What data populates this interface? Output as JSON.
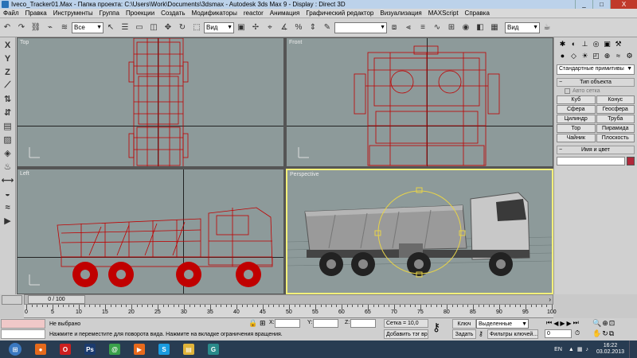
{
  "window": {
    "title": "Iveco_Tracker01.Max    - Папка проекта: C:\\Users\\Work\\Documents\\3dsmax    - Autodesk 3ds Max 9    - Display : Direct 3D",
    "minimize": "_",
    "maximize": "□",
    "close": "X"
  },
  "menu": [
    "Файл",
    "Правка",
    "Инструменты",
    "Группа",
    "Проекции",
    "Создать",
    "Модификаторы",
    "reactor",
    "Анимация",
    "Графический редактор",
    "Визуализация",
    "MAXScript",
    "Справка"
  ],
  "toolbar": {
    "selection_filter": "Все",
    "coord_system": "Вид",
    "named_selection": "",
    "render_view": "Вид"
  },
  "left_toolbar": [
    "X",
    "Y",
    "Z"
  ],
  "viewports": {
    "top": "Top",
    "front": "Front",
    "left": "Left",
    "perspective": "Perspective"
  },
  "command_panel": {
    "category": "Стандартные примитивы",
    "rollout_object_type": "Тип объекта",
    "auto_grid": "Авто сетка",
    "buttons": [
      "Куб",
      "Конус",
      "Сфера",
      "Геосфера",
      "Цилиндр",
      "Труба",
      "Тор",
      "Пирамида",
      "Чайник",
      "Плоскость"
    ],
    "rollout_name_color": "Имя и цвет",
    "object_color": "#b0283a"
  },
  "timeline": {
    "frame_display": "0 / 100",
    "ticks": [
      "0",
      "5",
      "10",
      "15",
      "20",
      "25",
      "30",
      "35",
      "40",
      "45",
      "50",
      "55",
      "60",
      "65",
      "70",
      "75",
      "80",
      "85",
      "90",
      "95",
      "100"
    ]
  },
  "status": {
    "selection": "Не выбрано",
    "prompt": "Нажмите и переместите для поворота вида. Нажмите на вкладке ограничения вращения.",
    "x_label": "X:",
    "y_label": "Y:",
    "z_label": "Z:",
    "x_value": "",
    "y_value": "",
    "z_value": "",
    "grid": "Сетка = 10,0",
    "add_time_tag": "Добавить тэг врем",
    "auto_key": "Ключ",
    "set_key": "Задать",
    "key_mode": "Выделенные",
    "key_filters": "Фильтры ключей...",
    "current_frame": "0"
  },
  "taskbar": {
    "apps": [
      {
        "name": "start-button",
        "color": "#3a78c0",
        "glyph": "⊞"
      },
      {
        "name": "firefox",
        "color": "#e56a1c",
        "glyph": "●"
      },
      {
        "name": "opera",
        "color": "#cc1f1f",
        "glyph": "O"
      },
      {
        "name": "photoshop",
        "color": "#1b3b6e",
        "glyph": "Ps"
      },
      {
        "name": "icq",
        "color": "#3aa14a",
        "glyph": "@"
      },
      {
        "name": "media-player",
        "color": "#e86a1c",
        "glyph": "▶"
      },
      {
        "name": "skype",
        "color": "#1a9be0",
        "glyph": "S"
      },
      {
        "name": "explorer",
        "color": "#e0b43a",
        "glyph": "▤"
      },
      {
        "name": "3dsmax",
        "color": "#2a8a8a",
        "glyph": "G"
      }
    ],
    "lang": "EN",
    "time": "16:22",
    "date": "03.02.2013"
  }
}
